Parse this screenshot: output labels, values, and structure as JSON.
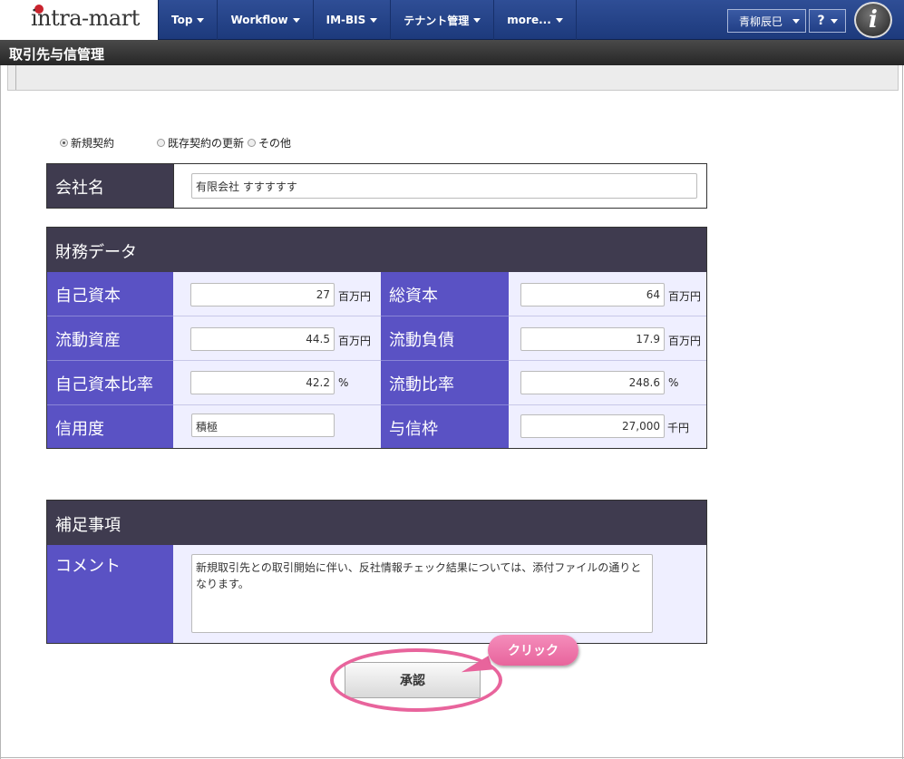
{
  "nav": {
    "logo": "intra-mart",
    "menu": [
      {
        "label": "Top"
      },
      {
        "label": "Workflow"
      },
      {
        "label": "IM-BIS"
      },
      {
        "label": "テナント管理"
      },
      {
        "label": "more..."
      }
    ],
    "user_name": "青柳辰巳",
    "help_label": "?"
  },
  "page_title": "取引先与信管理",
  "contract_type": {
    "options": [
      "新規契約",
      "既存契約の更新",
      "その他"
    ],
    "selected": "新規契約"
  },
  "company": {
    "label": "会社名",
    "value": "有限会社 すすすすす"
  },
  "finance": {
    "heading": "財務データ",
    "equity": {
      "label": "自己資本",
      "value": "27",
      "unit": "百万円"
    },
    "total_capital": {
      "label": "総資本",
      "value": "64",
      "unit": "百万円"
    },
    "current_assets": {
      "label": "流動資産",
      "value": "44.5",
      "unit": "百万円"
    },
    "current_liabilities": {
      "label": "流動負債",
      "value": "17.9",
      "unit": "百万円"
    },
    "equity_ratio": {
      "label": "自己資本比率",
      "value": "42.2",
      "unit": "%"
    },
    "current_ratio": {
      "label": "流動比率",
      "value": "248.6",
      "unit": "%"
    },
    "credit_rating": {
      "label": "信用度",
      "value": "積極"
    },
    "credit_limit": {
      "label": "与信枠",
      "value": "27,000",
      "unit": "千円"
    }
  },
  "supplement": {
    "heading": "補足事項",
    "comment_label": "コメント",
    "comment": "新規取引先との取引開始に伴い、反社情報チェック結果については、添付ファイルの通りとなります。"
  },
  "actions": {
    "approve_label": "承認",
    "callout": "クリック"
  }
}
